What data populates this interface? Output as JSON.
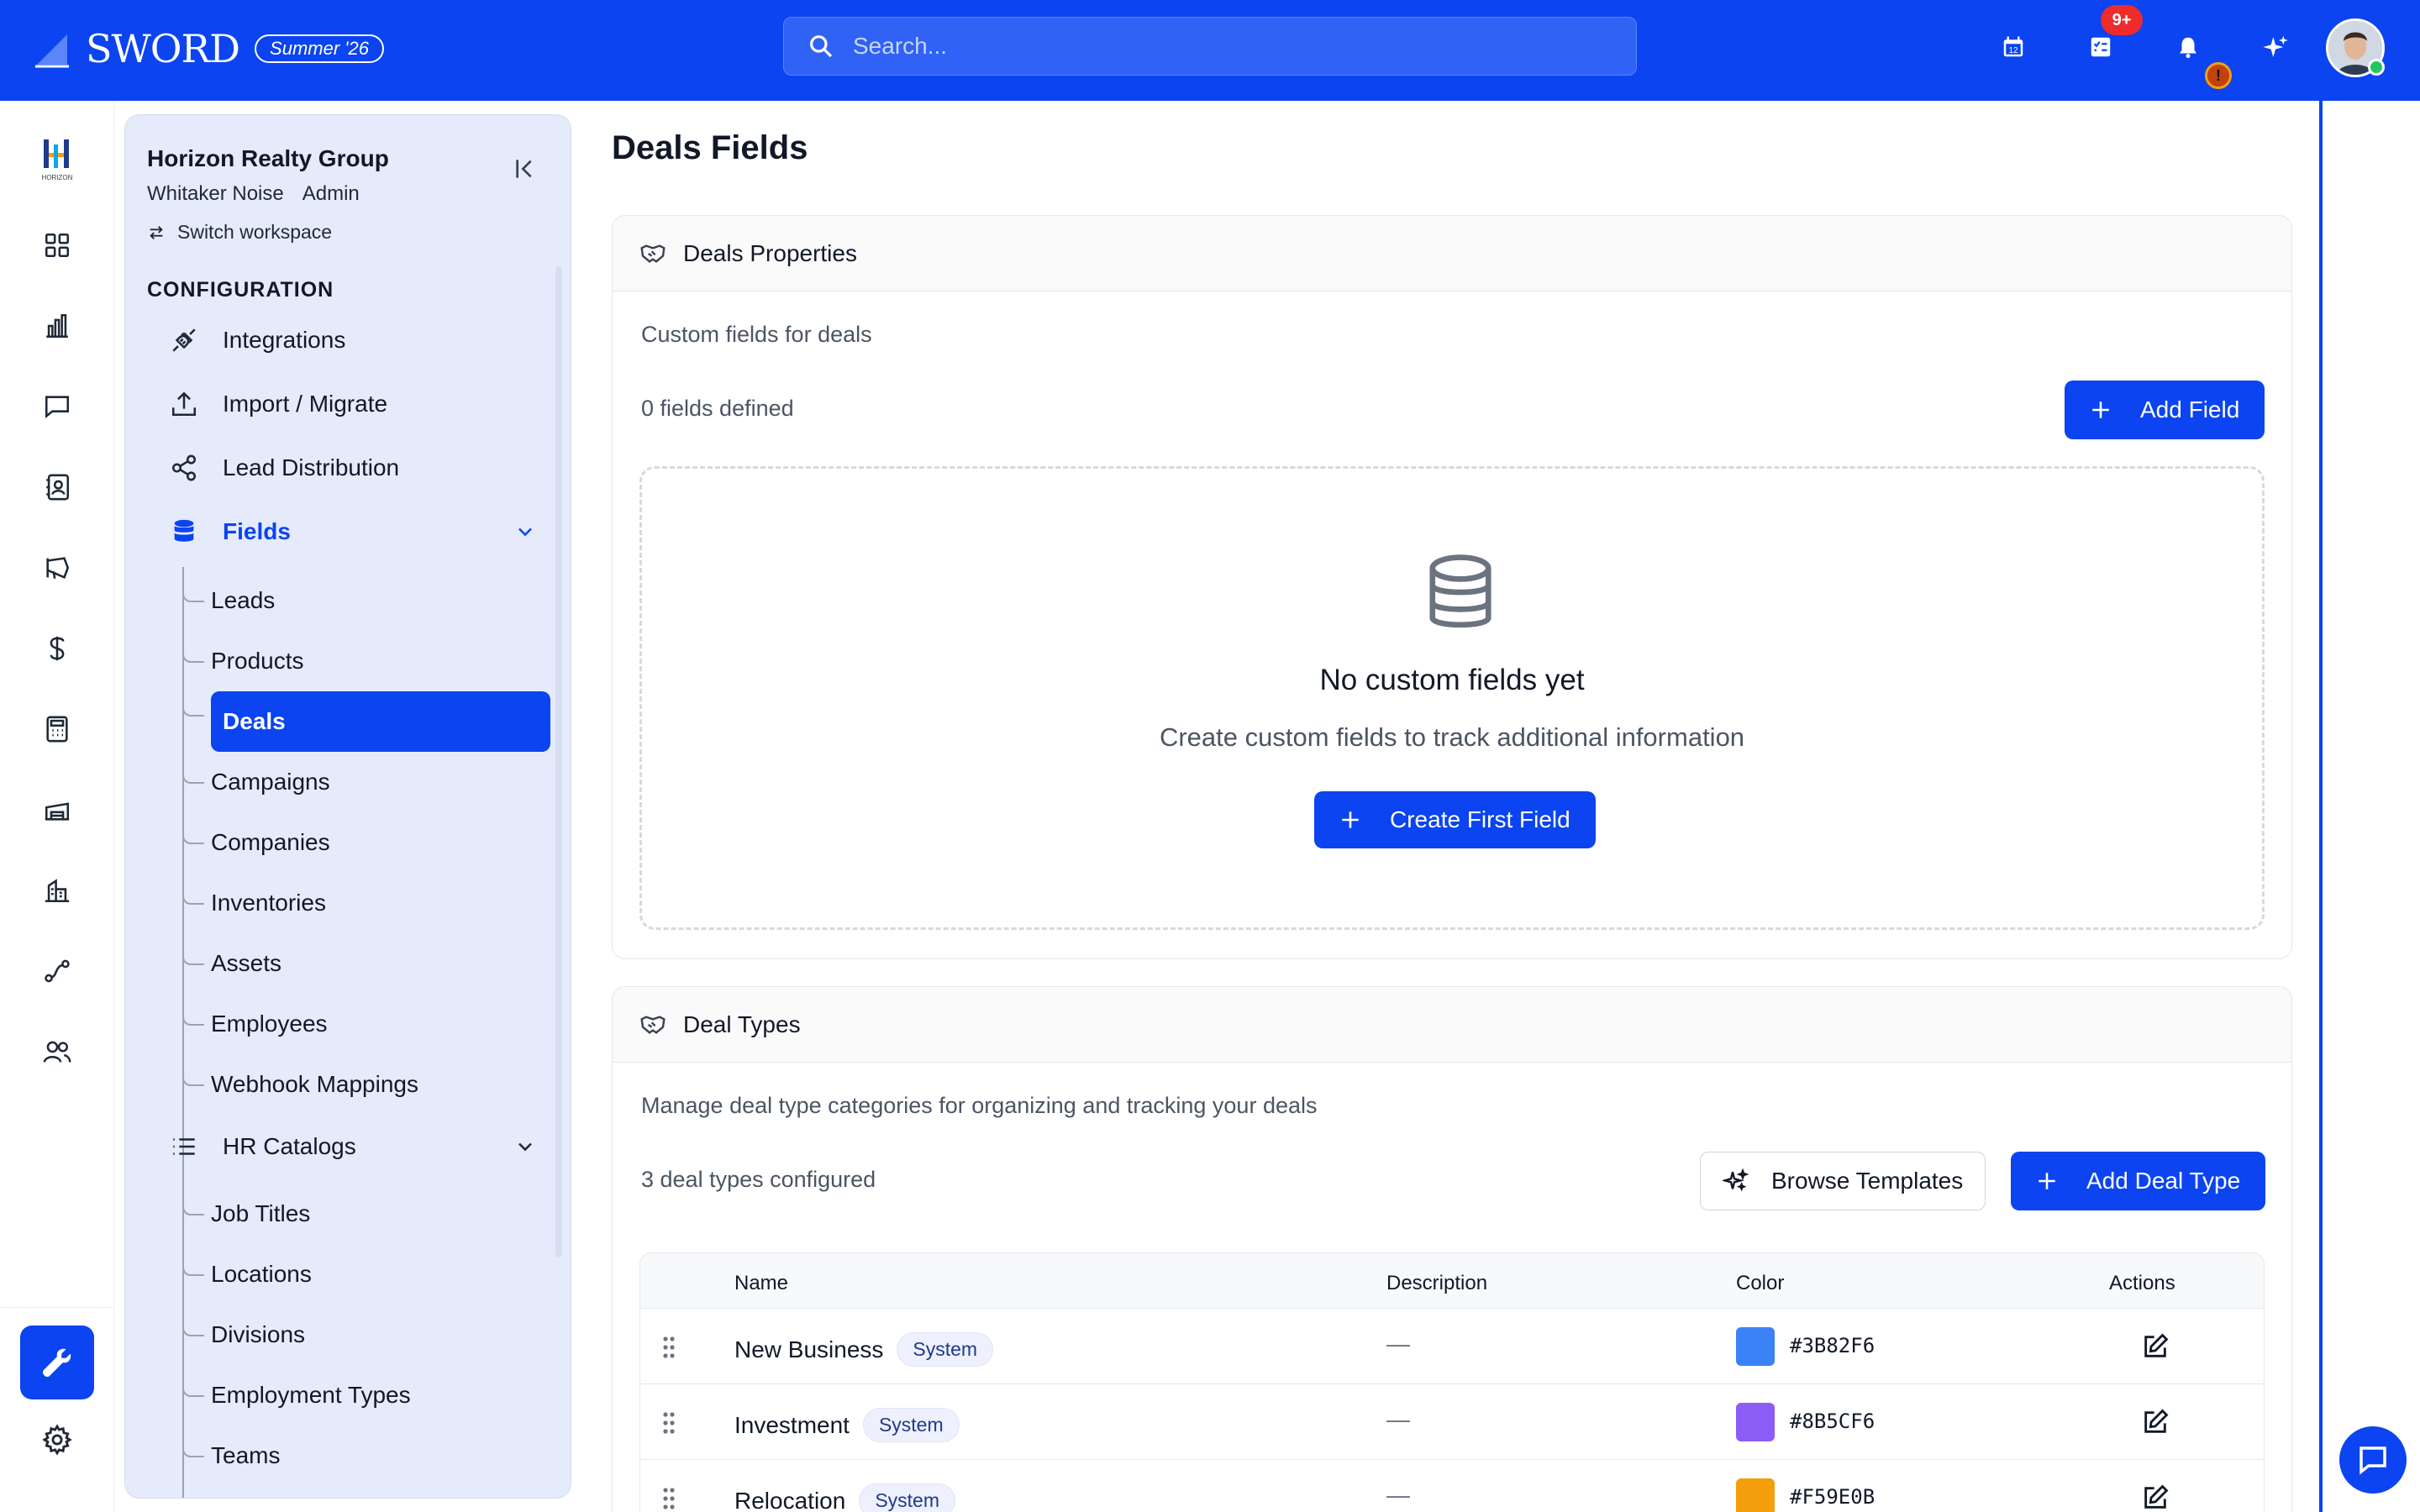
{
  "header": {
    "logo_text": "SWORD",
    "release": "Summer '26",
    "search_placeholder": "Search...",
    "tasks_badge": "9+",
    "alert_badge": "!"
  },
  "workspace": {
    "name": "Horizon Realty Group",
    "user": "Whitaker Noise",
    "role": "Admin",
    "switch_label": "Switch workspace",
    "rail_logo_text": "HORIZON"
  },
  "rail": {
    "icons": [
      "grid-icon",
      "bar-chart-icon",
      "message-icon",
      "contacts-icon",
      "megaphone-icon",
      "dollar-icon",
      "calculator-icon",
      "warehouse-icon",
      "building-icon",
      "route-icon",
      "users-icon",
      "wrench-icon",
      "gear-icon"
    ]
  },
  "config": {
    "section_title": "CONFIGURATION",
    "items": [
      {
        "label": "Integrations",
        "icon": "plug-icon"
      },
      {
        "label": "Import / Migrate",
        "icon": "upload-icon"
      },
      {
        "label": "Lead Distribution",
        "icon": "share-icon"
      },
      {
        "label": "Fields",
        "icon": "database-icon"
      },
      {
        "label": "HR Catalogs",
        "icon": "list-icon"
      }
    ],
    "fields_sub": [
      "Leads",
      "Products",
      "Deals",
      "Campaigns",
      "Companies",
      "Inventories",
      "Assets",
      "Employees",
      "Webhook Mappings"
    ],
    "hr_sub": [
      "Job Titles",
      "Locations",
      "Divisions",
      "Employment Types",
      "Teams"
    ],
    "active_sub": "Deals"
  },
  "page": {
    "title": "Deals Fields"
  },
  "properties": {
    "title": "Deals Properties",
    "description": "Custom fields for deals",
    "count": "0 fields defined",
    "add_button": "Add Field",
    "empty_title": "No custom fields yet",
    "empty_sub": "Create custom fields to track additional information",
    "empty_button": "Create First Field"
  },
  "deal_types": {
    "title": "Deal Types",
    "description": "Manage deal type categories for organizing and tracking your deals",
    "count": "3 deal types configured",
    "browse_button": "Browse Templates",
    "add_button": "Add Deal Type",
    "columns": [
      "Name",
      "Description",
      "Color",
      "Actions"
    ],
    "rows": [
      {
        "name": "New Business",
        "badge": "System",
        "description": "—",
        "color": "#3B82F6"
      },
      {
        "name": "Investment",
        "badge": "System",
        "description": "—",
        "color": "#8B5CF6"
      },
      {
        "name": "Relocation",
        "badge": "System",
        "description": "—",
        "color": "#F59E0B"
      }
    ]
  },
  "colors": {
    "brand": "#0B44F0",
    "panel_bg": "#E6EBFB",
    "badge_red": "#EF2B2B"
  }
}
